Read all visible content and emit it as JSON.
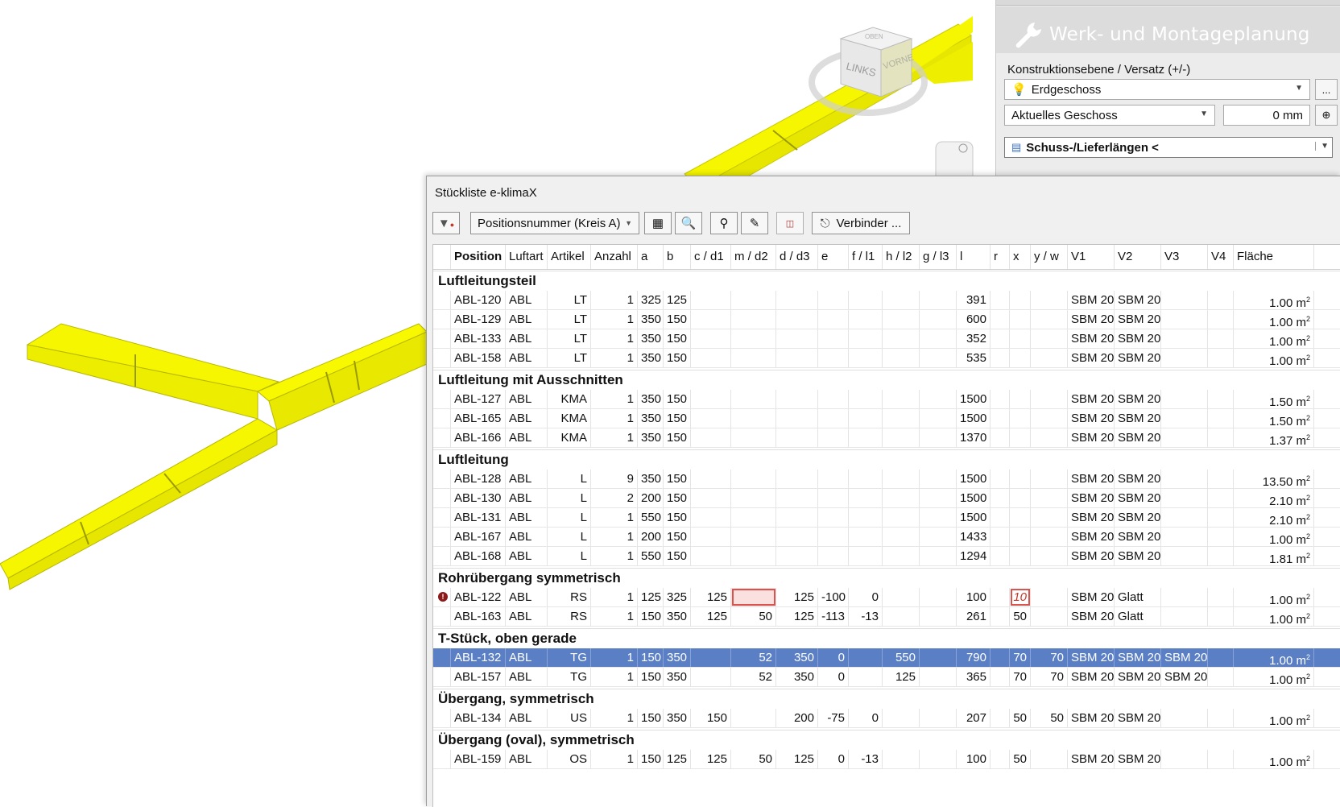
{
  "viewport": {
    "duct_color": "#f5f500",
    "viewcube": {
      "face_left": "LINKS",
      "face_front": "VORNE",
      "face_top": "OBEN"
    }
  },
  "right_panel": {
    "title": "Werk- und Montageplanung",
    "title_icon": "wrench-icon",
    "construction_label": "Konstruktionsebene / Versatz (+/-)",
    "level_combo": "Erdgeschoss",
    "level_button": "...",
    "storey_combo": "Aktuelles Geschoss",
    "offset_value": "0 mm",
    "lengths_combo": "Schuss-/Lieferlängen <"
  },
  "dialog": {
    "title": "Stückliste e-klimaX",
    "toolbar": {
      "sort_combo": "Positionsnummer (Kreis A)",
      "connector_button": "Verbinder ..."
    },
    "columns": [
      "",
      "Position",
      "Luftart",
      "Artikel",
      "Anzahl",
      "a",
      "b",
      "c / d1",
      "m / d2",
      "d / d3",
      "e",
      "f / l1",
      "h / l2",
      "g / l3",
      "l",
      "r",
      "x",
      "y / w",
      "V1",
      "V2",
      "V3",
      "V4",
      "Fläche"
    ],
    "area_unit": "m",
    "area_unit_exp": "2",
    "groups": [
      {
        "name": "Luftleitungsteil",
        "rows": [
          [
            "",
            "ABL-120",
            "ABL",
            "LT",
            "1",
            "325",
            "125",
            "",
            "",
            "",
            "",
            "",
            "",
            "",
            "391",
            "",
            "",
            "",
            "SBM 20",
            "SBM 20",
            "",
            "",
            "1.00"
          ],
          [
            "",
            "ABL-129",
            "ABL",
            "LT",
            "1",
            "350",
            "150",
            "",
            "",
            "",
            "",
            "",
            "",
            "",
            "600",
            "",
            "",
            "",
            "SBM 20",
            "SBM 20",
            "",
            "",
            "1.00"
          ],
          [
            "",
            "ABL-133",
            "ABL",
            "LT",
            "1",
            "350",
            "150",
            "",
            "",
            "",
            "",
            "",
            "",
            "",
            "352",
            "",
            "",
            "",
            "SBM 20",
            "SBM 20",
            "",
            "",
            "1.00"
          ],
          [
            "",
            "ABL-158",
            "ABL",
            "LT",
            "1",
            "350",
            "150",
            "",
            "",
            "",
            "",
            "",
            "",
            "",
            "535",
            "",
            "",
            "",
            "SBM 20",
            "SBM 20",
            "",
            "",
            "1.00"
          ]
        ]
      },
      {
        "name": "Luftleitung mit Ausschnitten",
        "rows": [
          [
            "",
            "ABL-127",
            "ABL",
            "KMA",
            "1",
            "350",
            "150",
            "",
            "",
            "",
            "",
            "",
            "",
            "",
            "1500",
            "",
            "",
            "",
            "SBM 20",
            "SBM 20",
            "",
            "",
            "1.50"
          ],
          [
            "",
            "ABL-165",
            "ABL",
            "KMA",
            "1",
            "350",
            "150",
            "",
            "",
            "",
            "",
            "",
            "",
            "",
            "1500",
            "",
            "",
            "",
            "SBM 20",
            "SBM 20",
            "",
            "",
            "1.50"
          ],
          [
            "",
            "ABL-166",
            "ABL",
            "KMA",
            "1",
            "350",
            "150",
            "",
            "",
            "",
            "",
            "",
            "",
            "",
            "1370",
            "",
            "",
            "",
            "SBM 20",
            "SBM 20",
            "",
            "",
            "1.37"
          ]
        ]
      },
      {
        "name": "Luftleitung",
        "rows": [
          [
            "",
            "ABL-128",
            "ABL",
            "L",
            "9",
            "350",
            "150",
            "",
            "",
            "",
            "",
            "",
            "",
            "",
            "1500",
            "",
            "",
            "",
            "SBM 20",
            "SBM 20",
            "",
            "",
            "13.50"
          ],
          [
            "",
            "ABL-130",
            "ABL",
            "L",
            "2",
            "200",
            "150",
            "",
            "",
            "",
            "",
            "",
            "",
            "",
            "1500",
            "",
            "",
            "",
            "SBM 20",
            "SBM 20",
            "",
            "",
            "2.10"
          ],
          [
            "",
            "ABL-131",
            "ABL",
            "L",
            "1",
            "550",
            "150",
            "",
            "",
            "",
            "",
            "",
            "",
            "",
            "1500",
            "",
            "",
            "",
            "SBM 20",
            "SBM 20",
            "",
            "",
            "2.10"
          ],
          [
            "",
            "ABL-167",
            "ABL",
            "L",
            "1",
            "200",
            "150",
            "",
            "",
            "",
            "",
            "",
            "",
            "",
            "1433",
            "",
            "",
            "",
            "SBM 20",
            "SBM 20",
            "",
            "",
            "1.00"
          ],
          [
            "",
            "ABL-168",
            "ABL",
            "L",
            "1",
            "550",
            "150",
            "",
            "",
            "",
            "",
            "",
            "",
            "",
            "1294",
            "",
            "",
            "",
            "SBM 20",
            "SBM 20",
            "",
            "",
            "1.81"
          ]
        ]
      },
      {
        "name": "Rohrübergang symmetrisch",
        "rows": [
          [
            "!",
            "ABL-122",
            "ABL",
            "RS",
            "1",
            "125",
            "325",
            "125",
            "",
            "125",
            "-100",
            "0",
            "",
            "",
            "100",
            "",
            "10",
            "",
            "SBM 20",
            "Glatt",
            "",
            "",
            "1.00"
          ],
          [
            "",
            "ABL-163",
            "ABL",
            "RS",
            "1",
            "150",
            "350",
            "125",
            "50",
            "125",
            "-113",
            "-13",
            "",
            "",
            "261",
            "",
            "50",
            "",
            "SBM 20",
            "Glatt",
            "",
            "",
            "1.00"
          ]
        ]
      },
      {
        "name": "T-Stück, oben gerade",
        "rows": [
          [
            "",
            "ABL-132",
            "ABL",
            "TG",
            "1",
            "150",
            "350",
            "",
            "52",
            "350",
            "0",
            "",
            "550",
            "",
            "790",
            "",
            "70",
            "70",
            "SBM 20",
            "SBM 20",
            "SBM 20",
            "",
            "1.00"
          ],
          [
            "",
            "ABL-157",
            "ABL",
            "TG",
            "1",
            "150",
            "350",
            "",
            "52",
            "350",
            "0",
            "",
            "125",
            "",
            "365",
            "",
            "70",
            "70",
            "SBM 20",
            "SBM 20",
            "SBM 20",
            "",
            "1.00"
          ]
        ]
      },
      {
        "name": "Übergang, symmetrisch",
        "rows": [
          [
            "",
            "ABL-134",
            "ABL",
            "US",
            "1",
            "150",
            "350",
            "150",
            "",
            "200",
            "-75",
            "0",
            "",
            "",
            "207",
            "",
            "50",
            "50",
            "SBM 20",
            "SBM 20",
            "",
            "",
            "1.00"
          ]
        ]
      },
      {
        "name": "Übergang (oval), symmetrisch",
        "rows": [
          [
            "",
            "ABL-159",
            "ABL",
            "OS",
            "1",
            "150",
            "125",
            "125",
            "50",
            "125",
            "0",
            "-13",
            "",
            "",
            "100",
            "",
            "50",
            "",
            "SBM 20",
            "SBM 20",
            "",
            "",
            "1.00"
          ]
        ]
      }
    ],
    "selected_position": "ABL-132",
    "error_row": "ABL-122",
    "selection_color": "#5a7fc4",
    "error_color": "#d9534f"
  }
}
